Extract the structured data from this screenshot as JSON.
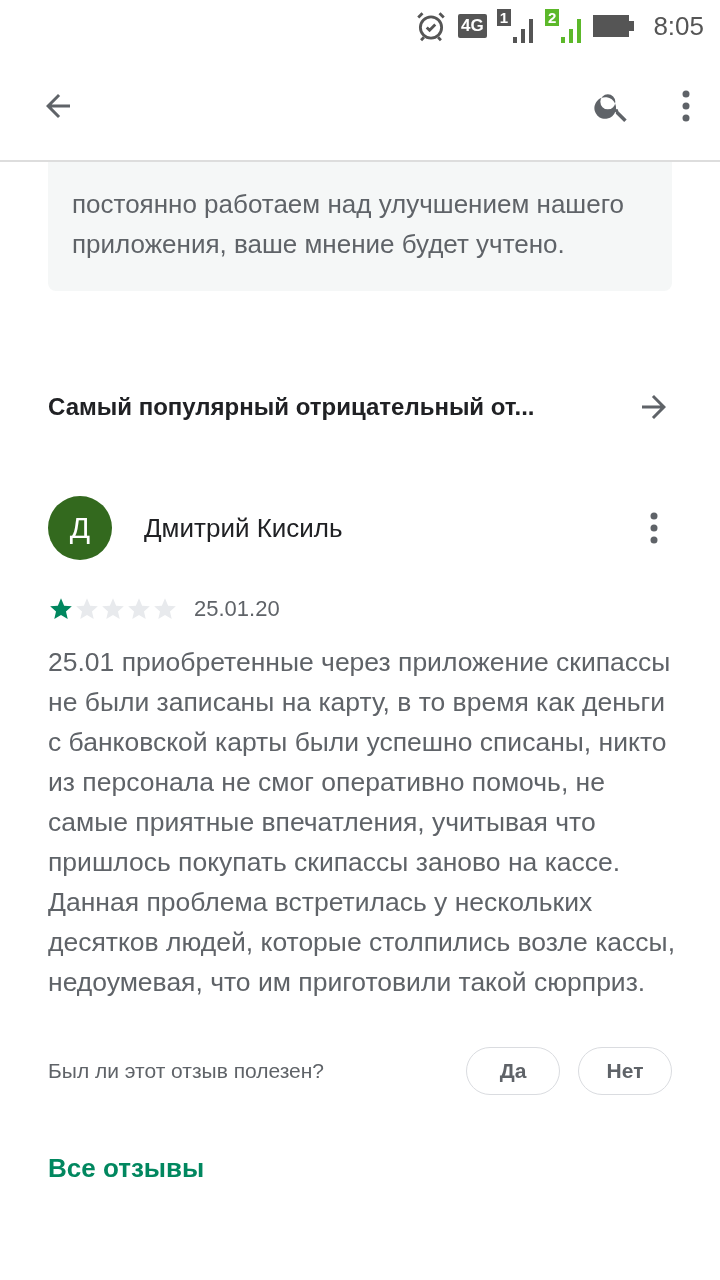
{
  "status_bar": {
    "network": "4G",
    "sim_1": "1",
    "sim_2": "2",
    "time": "8:05"
  },
  "developer_reply": {
    "text": "постоянно работаем над улучшением нашего приложения, ваше мнение будет учтено."
  },
  "section": {
    "title": "Самый популярный отрицательный от..."
  },
  "review": {
    "avatar_letter": "Д",
    "author": "Дмитрий Кисиль",
    "stars": 1,
    "date": "25.01.20",
    "text": "25.01 приобретенные через приложение скипассы не были записаны на карту, в то время как деньги с банковской карты были успешно списаны, никто из персонала не смог оперативно помочь, не самые приятные впечатления, учитывая что пришлось покупать скипассы заново на кассе. Данная проблема встретилась у нескольких десятков людей, которые столпились возле кассы, недоумевая, что им приготовили такой сюрприз."
  },
  "helpful": {
    "question": "Был ли этот отзыв полезен?",
    "buttons": [
      "Да",
      "Нет"
    ]
  },
  "all_reviews_link": "Все отзывы"
}
